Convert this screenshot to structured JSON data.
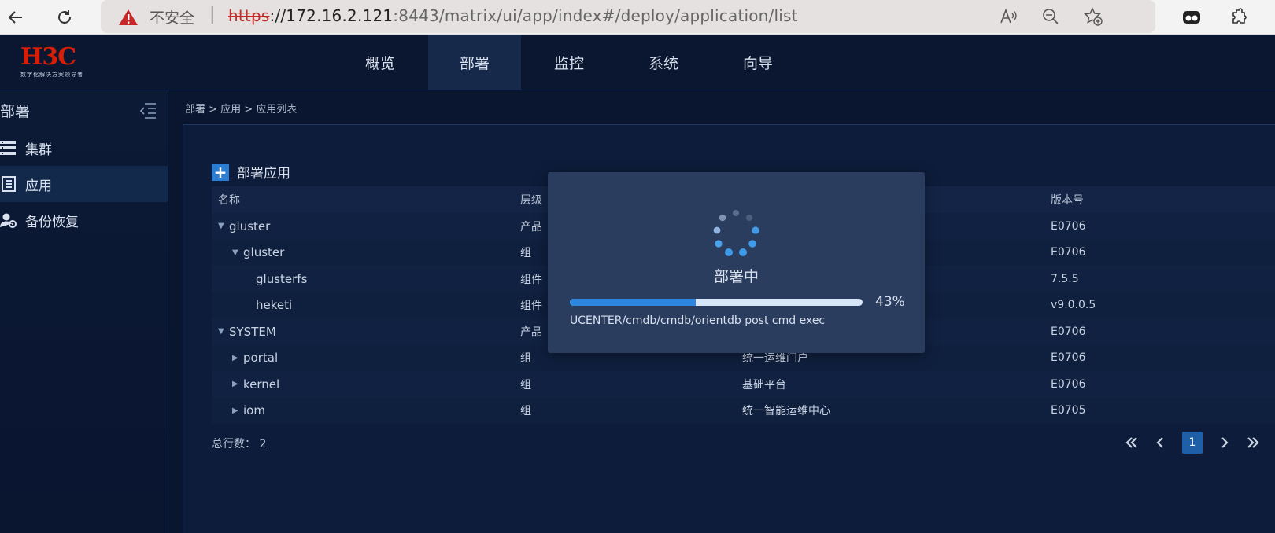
{
  "browser": {
    "security_label": "不安全",
    "url_proto": "https",
    "url_host": "://172.16.2.121",
    "url_rest": ":8443/matrix/ui/app/index#/deploy/application/list"
  },
  "brand": {
    "logo_text": "H3C",
    "tagline": "数字化解决方案领导者",
    "accent_color": "#d81e06"
  },
  "nav": {
    "items": [
      {
        "label": "概览"
      },
      {
        "label": "部署",
        "active": true
      },
      {
        "label": "监控"
      },
      {
        "label": "系统"
      },
      {
        "label": "向导"
      }
    ]
  },
  "sidebar": {
    "title": "部署",
    "items": [
      {
        "label": "集群",
        "icon": "cluster-icon"
      },
      {
        "label": "应用",
        "icon": "app-list-icon",
        "active": true
      },
      {
        "label": "备份恢复",
        "icon": "backup-user-icon"
      }
    ]
  },
  "breadcrumb": "部署 > 应用 > 应用列表",
  "main": {
    "deploy_label": "部署应用",
    "columns": {
      "name": "名称",
      "level": "层级",
      "version": "版本号"
    },
    "rows": [
      {
        "name": "gluster",
        "level": "产品",
        "desc": "",
        "version": "E0706",
        "depth": 0,
        "expanded": true
      },
      {
        "name": "gluster",
        "level": "组",
        "desc": "",
        "version": "E0706",
        "depth": 1,
        "expanded": true
      },
      {
        "name": "glusterfs",
        "level": "组件",
        "desc": "",
        "version": "7.5.5",
        "depth": 2,
        "expanded": null
      },
      {
        "name": "heketi",
        "level": "组件",
        "desc": "",
        "version": "v9.0.0.5",
        "depth": 2,
        "expanded": null
      },
      {
        "name": "SYSTEM",
        "level": "产品",
        "desc": "",
        "version": "E0706",
        "depth": 0,
        "expanded": true
      },
      {
        "name": "portal",
        "level": "组",
        "desc": "统一运维门户",
        "version": "E0706",
        "depth": 1,
        "expanded": false
      },
      {
        "name": "kernel",
        "level": "组",
        "desc": "基础平台",
        "version": "E0706",
        "depth": 1,
        "expanded": false
      },
      {
        "name": "iom",
        "level": "组",
        "desc": "统一智能运维中心",
        "version": "E0705",
        "depth": 1,
        "expanded": false
      }
    ],
    "total_label": "总行数：",
    "total_count": "2",
    "current_page": "1"
  },
  "modal": {
    "title": "部署中",
    "progress": 0.43,
    "progress_label": "43%",
    "message": "UCENTER/cmdb/cmdb/orientdb post cmd exec"
  }
}
